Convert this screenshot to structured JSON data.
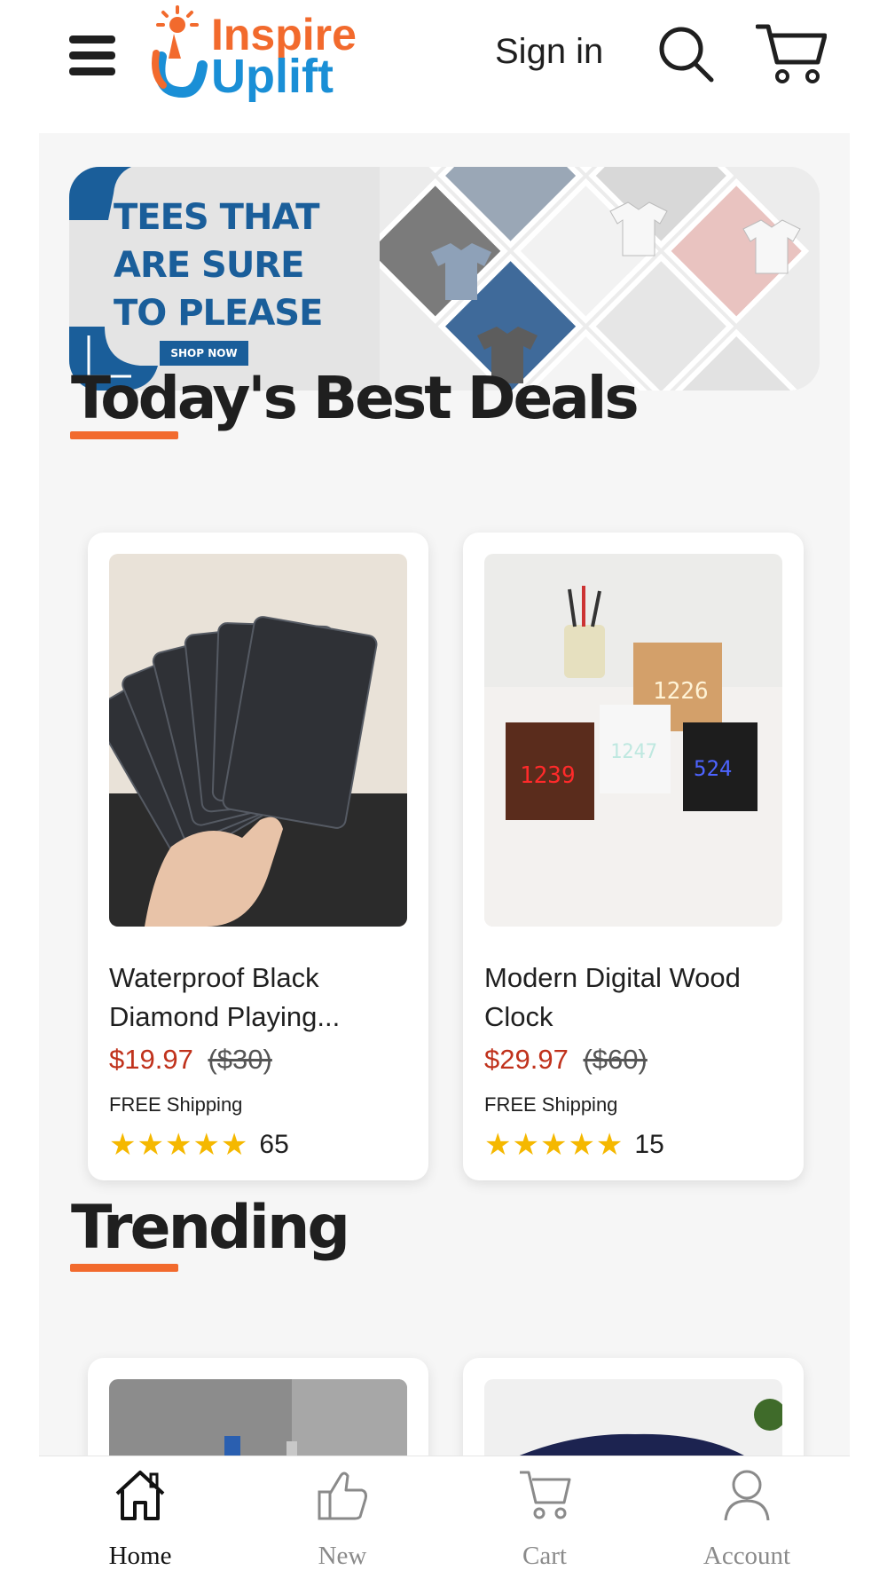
{
  "header": {
    "logo_line1": "Inspire",
    "logo_line2": "Uplift",
    "signin_label": "Sign in"
  },
  "banner": {
    "line1": "TEES THAT",
    "line2": "ARE SURE",
    "line3": "TO PLEASE",
    "cta_label": "SHOP NOW"
  },
  "deals": {
    "title": "Today's Best Deals",
    "products": [
      {
        "title_line1": "Waterproof Black",
        "title_line2": "Diamond Playing...",
        "price": "$19.97",
        "old_price": "($30)",
        "shipping": "FREE Shipping",
        "stars": "★★★★★",
        "review_count": "65"
      },
      {
        "title_line1": "Modern Digital Wood",
        "title_line2": "Clock",
        "price": "$29.97",
        "old_price": "($60)",
        "shipping": "FREE Shipping",
        "stars": "★★★★★",
        "review_count": "15"
      }
    ]
  },
  "trending": {
    "title": "Trending"
  },
  "nav": {
    "items": [
      {
        "label": "Home",
        "icon": "home-icon"
      },
      {
        "label": "New",
        "icon": "thumbs-up-icon"
      },
      {
        "label": "Cart",
        "icon": "cart-icon"
      },
      {
        "label": "Account",
        "icon": "account-icon"
      }
    ]
  },
  "colors": {
    "accent_orange": "#f26a2d",
    "brand_blue": "#1a8fd6",
    "price_red": "#c0321c",
    "star_yellow": "#f5b800"
  }
}
